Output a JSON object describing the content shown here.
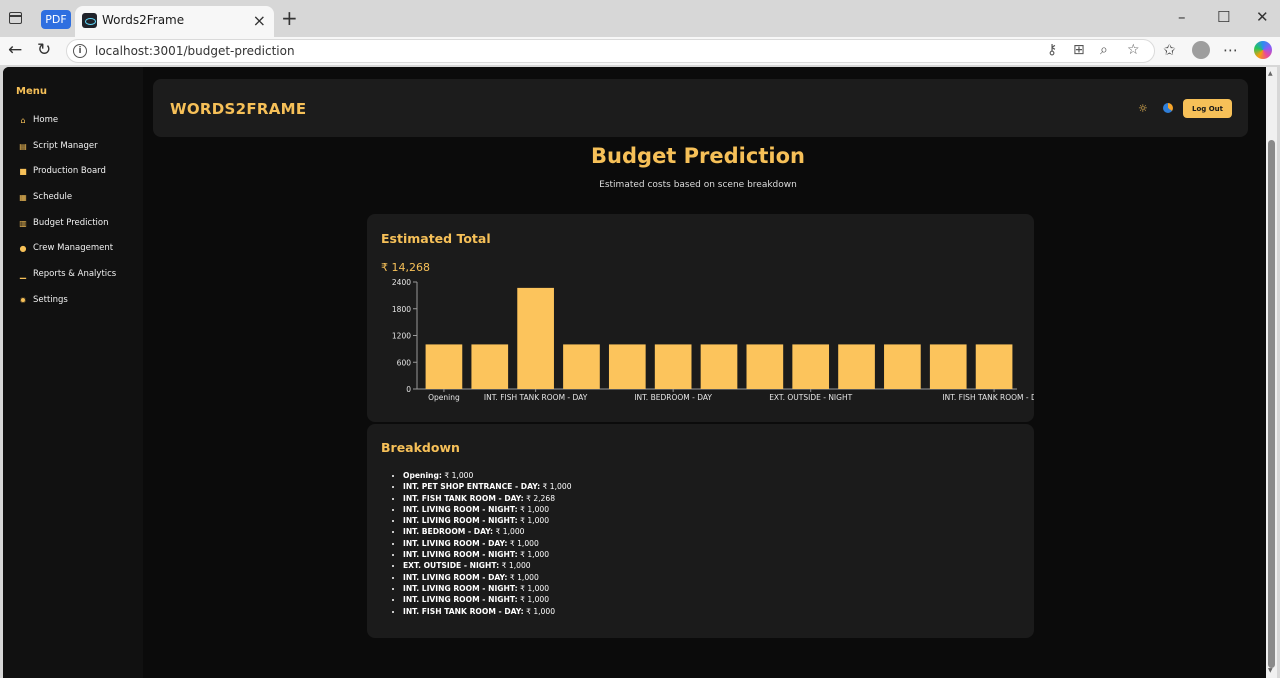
{
  "browser": {
    "pdf_tab_label": "PDF",
    "tab_title": "Words2Frame",
    "url": "localhost:3001/budget-prediction"
  },
  "sidebar": {
    "title": "Menu",
    "items": [
      {
        "label": "Home",
        "icon": "home-icon"
      },
      {
        "label": "Script Manager",
        "icon": "file-icon"
      },
      {
        "label": "Production Board",
        "icon": "video-icon"
      },
      {
        "label": "Schedule",
        "icon": "calendar-icon"
      },
      {
        "label": "Budget Prediction",
        "icon": "calculator-icon"
      },
      {
        "label": "Crew Management",
        "icon": "users-icon"
      },
      {
        "label": "Reports & Analytics",
        "icon": "chart-icon"
      },
      {
        "label": "Settings",
        "icon": "gear-icon"
      }
    ]
  },
  "header": {
    "brand": "WORDS2FRAME",
    "logout_label": "Log Out"
  },
  "main": {
    "title": "Budget Prediction",
    "subtitle": "Estimated costs based on scene breakdown",
    "total_card_title": "Estimated Total",
    "total_value": "₹ 14,268",
    "breakdown_title": "Breakdown",
    "breakdown": [
      {
        "scene": "Opening:",
        "amount": " ₹ 1,000"
      },
      {
        "scene": "INT. PET SHOP ENTRANCE - DAY:",
        "amount": " ₹ 1,000"
      },
      {
        "scene": "INT. FISH TANK ROOM - DAY:",
        "amount": " ₹ 2,268"
      },
      {
        "scene": "INT. LIVING ROOM - NIGHT:",
        "amount": " ₹ 1,000"
      },
      {
        "scene": "INT. LIVING ROOM - NIGHT:",
        "amount": " ₹ 1,000"
      },
      {
        "scene": "INT. BEDROOM - DAY:",
        "amount": " ₹ 1,000"
      },
      {
        "scene": "INT. LIVING ROOM - DAY:",
        "amount": " ₹ 1,000"
      },
      {
        "scene": "INT. LIVING ROOM - NIGHT:",
        "amount": " ₹ 1,000"
      },
      {
        "scene": "EXT. OUTSIDE - NIGHT:",
        "amount": " ₹ 1,000"
      },
      {
        "scene": "INT. LIVING ROOM - DAY:",
        "amount": " ₹ 1,000"
      },
      {
        "scene": "INT. LIVING ROOM - NIGHT:",
        "amount": " ₹ 1,000"
      },
      {
        "scene": "INT. LIVING ROOM - NIGHT:",
        "amount": " ₹ 1,000"
      },
      {
        "scene": "INT. FISH TANK ROOM - DAY:",
        "amount": " ₹ 1,000"
      }
    ]
  },
  "chart_data": {
    "type": "bar",
    "categories": [
      "Opening",
      "INT. PET SHOP ENTRANCE - DAY",
      "INT. FISH TANK ROOM - DAY",
      "INT. LIVING ROOM - NIGHT",
      "INT. LIVING ROOM - NIGHT",
      "INT. BEDROOM - DAY",
      "INT. LIVING ROOM - DAY",
      "INT. LIVING ROOM - NIGHT",
      "EXT. OUTSIDE - NIGHT",
      "INT. LIVING ROOM - DAY",
      "INT. LIVING ROOM - NIGHT",
      "INT. LIVING ROOM - NIGHT",
      "INT. FISH TANK ROOM - DAY"
    ],
    "visible_tick_labels": [
      "Opening",
      "INT. FISH TANK ROOM - DAY",
      "INT. BEDROOM - DAY",
      "EXT. OUTSIDE - NIGHT",
      "INT. FISH TANK ROOM - DAY"
    ],
    "values": [
      1000,
      1000,
      2268,
      1000,
      1000,
      1000,
      1000,
      1000,
      1000,
      1000,
      1000,
      1000,
      1000
    ],
    "yticks": [
      0,
      600,
      1200,
      1800,
      2400
    ],
    "ylim": [
      0,
      2400
    ],
    "bar_color": "#fcc45c",
    "axis_color": "#9a9a9a",
    "title": "",
    "xlabel": "",
    "ylabel": ""
  },
  "colors": {
    "accent": "#f6c058",
    "background": "#0b0b0b",
    "card": "#1b1b1b"
  }
}
